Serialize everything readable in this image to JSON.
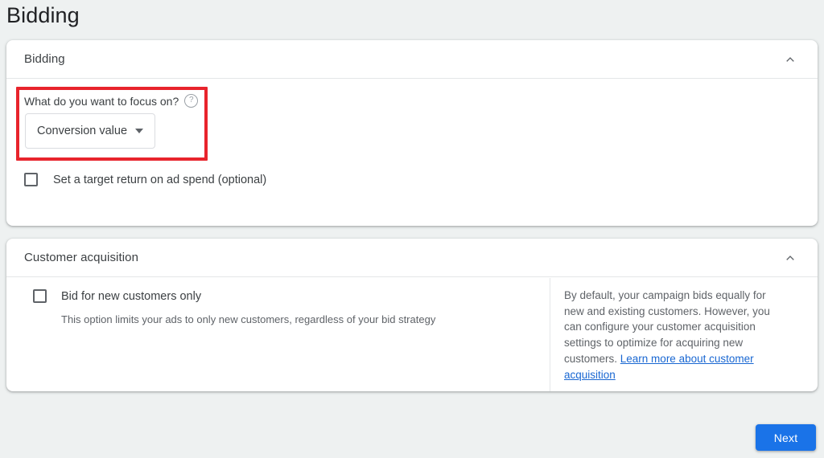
{
  "page": {
    "title": "Bidding"
  },
  "colors": {
    "accent": "#1a73e8",
    "highlight": "#e8242c",
    "link": "#1967d2",
    "page_background": "#eef1f1"
  },
  "cards": {
    "bidding": {
      "header_title": "Bidding",
      "collapse_icon": "chevron-up-icon",
      "focus_question": "What do you want to focus on?",
      "help_icon": "help-circle-icon",
      "focus_select_value": "Conversion value",
      "focus_select_arrow": "chevron-down-icon",
      "troas_checkbox_label": "Set a target return on ad spend (optional)",
      "troas_checked": false
    },
    "customer_acquisition": {
      "header_title": "Customer acquisition",
      "collapse_icon": "chevron-up-icon",
      "bid_new_customers_label": "Bid for new customers only",
      "bid_new_customers_checked": false,
      "bid_new_customers_sublabel": "This option limits your ads to only new customers, regardless of your bid strategy",
      "info_text": "By default, your campaign bids equally for new and existing customers. However, you can configure your customer acquisition settings to optimize for acquiring new customers. ",
      "info_link": "Learn more about customer acquisition"
    }
  },
  "footer": {
    "next_label": "Next"
  }
}
